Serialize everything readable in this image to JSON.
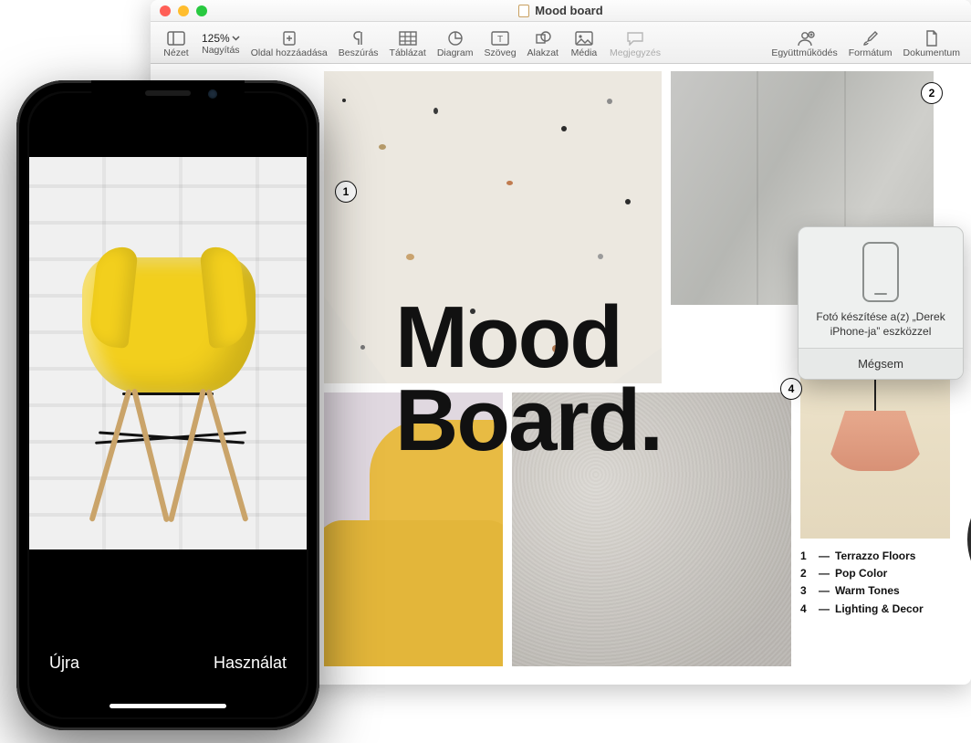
{
  "window": {
    "title": "Mood board"
  },
  "toolbar": {
    "view": "Nézet",
    "zoom_label": "Nagyítás",
    "zoom_value": "125%",
    "add_page": "Oldal hozzáadása",
    "insert": "Beszúrás",
    "table": "Táblázat",
    "chart": "Diagram",
    "text": "Szöveg",
    "shape": "Alakzat",
    "media": "Média",
    "comment": "Megjegyzés",
    "collab": "Együttműködés",
    "format": "Formátum",
    "document": "Dokumentum"
  },
  "headline": {
    "line1": "Mood",
    "line2": "Board."
  },
  "callouts": {
    "c1": "1",
    "c2": "2",
    "c4": "4"
  },
  "legend": {
    "items": [
      {
        "n": "1",
        "label": "Terrazzo Floors"
      },
      {
        "n": "2",
        "label": "Pop Color"
      },
      {
        "n": "3",
        "label": "Warm Tones"
      },
      {
        "n": "4",
        "label": "Lighting & Decor"
      }
    ]
  },
  "popover": {
    "message": "Fotó készítése a(z) „Derek iPhone-ja” eszközzel",
    "cancel": "Mégsem"
  },
  "phone": {
    "retake": "Újra",
    "use": "Használat"
  }
}
